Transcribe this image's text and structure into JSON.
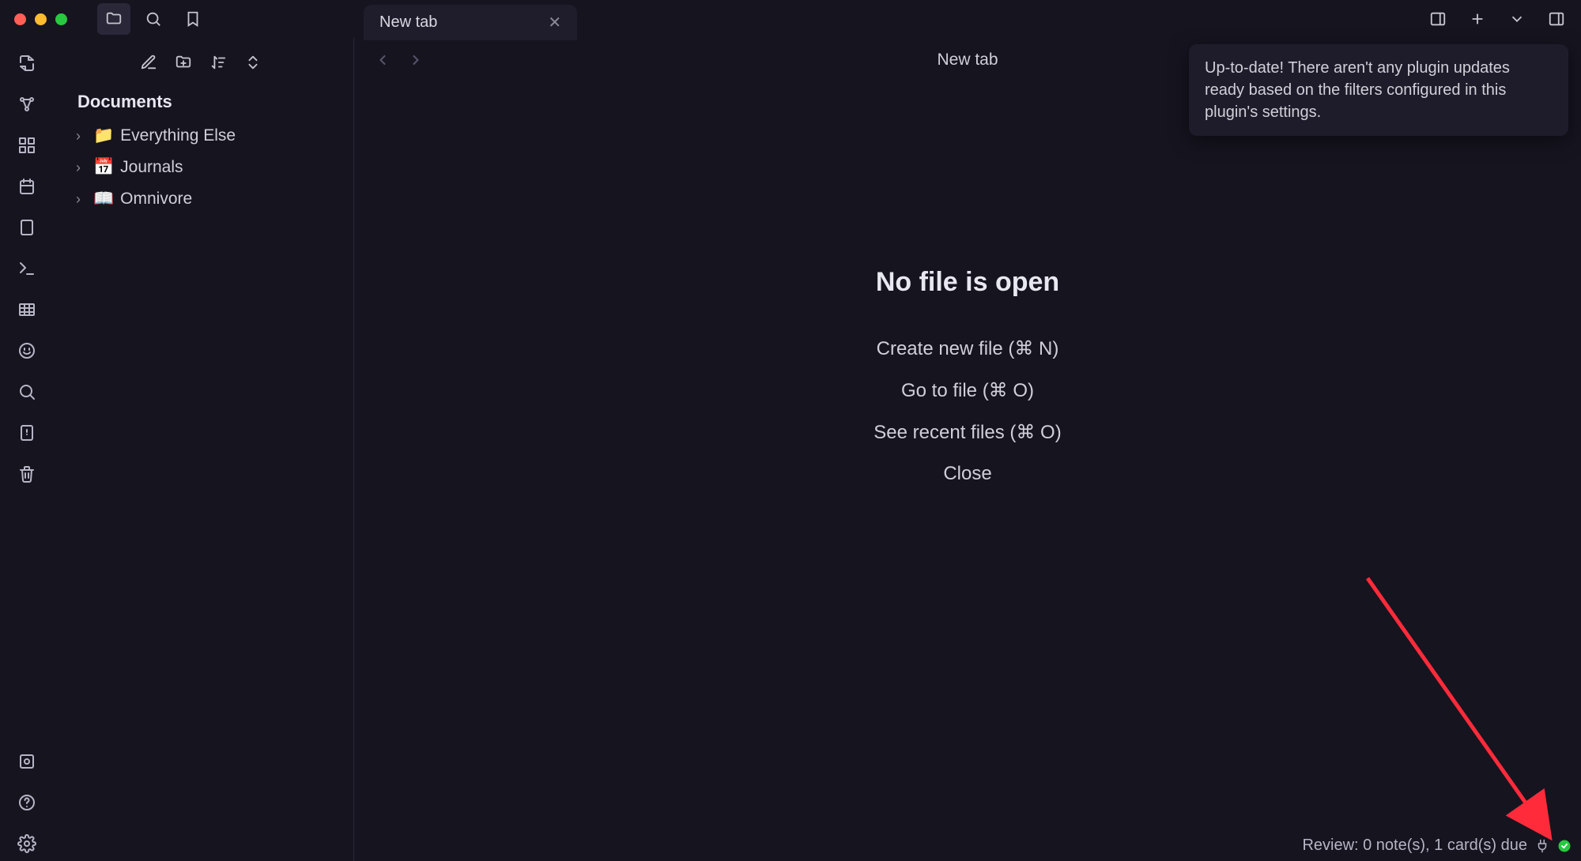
{
  "tab": {
    "title": "New tab"
  },
  "content_title": "New tab",
  "notification": "Up-to-date! There aren't any plugin updates ready based on the filters configured in this plugin's settings.",
  "sidebar": {
    "vault": "Documents",
    "items": [
      {
        "emoji": "📁",
        "label": "Everything Else"
      },
      {
        "emoji": "📅",
        "label": "Journals"
      },
      {
        "emoji": "📖",
        "label": "Omnivore"
      }
    ]
  },
  "empty": {
    "heading": "No file is open",
    "actions": [
      "Create new file (⌘ N)",
      "Go to file (⌘ O)",
      "See recent files (⌘ O)",
      "Close"
    ]
  },
  "status": "Review: 0 note(s), 1 card(s) due"
}
